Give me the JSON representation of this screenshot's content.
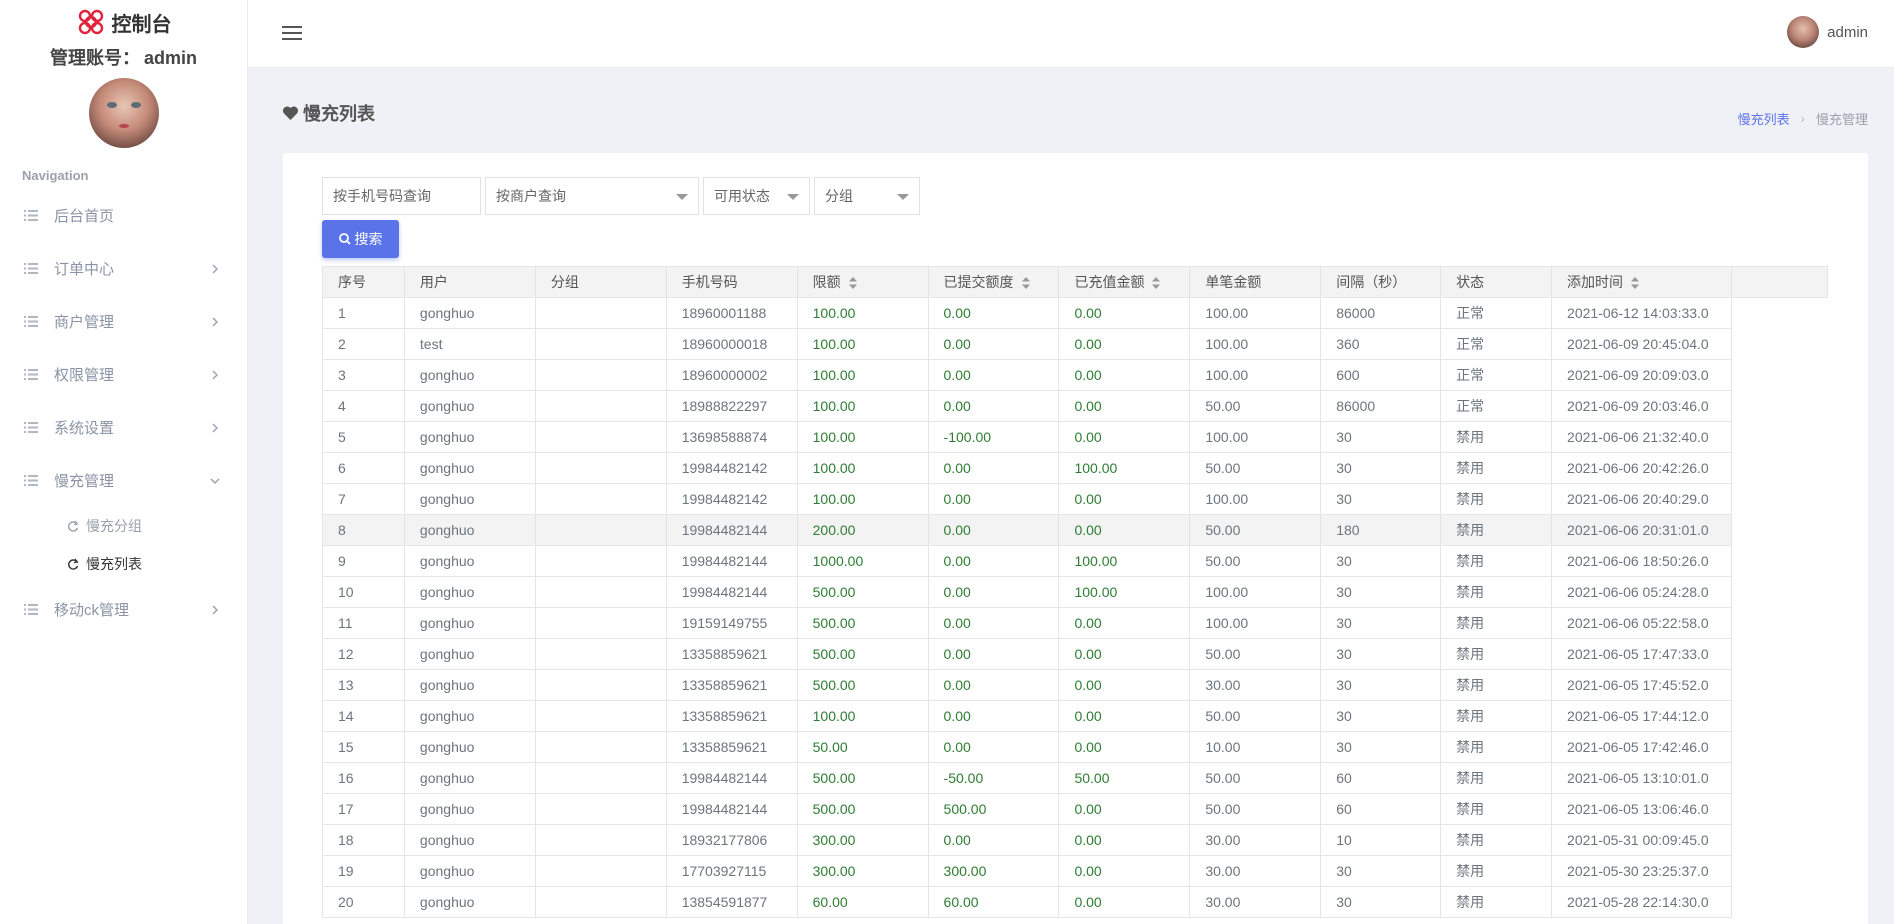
{
  "brand": {
    "title": "控制台"
  },
  "account": {
    "label": "管理账号：",
    "name": "admin"
  },
  "nav": {
    "header": "Navigation",
    "items": [
      {
        "label": "后台首页",
        "has_children": false
      },
      {
        "label": "订单中心",
        "has_children": true
      },
      {
        "label": "商户管理",
        "has_children": true
      },
      {
        "label": "权限管理",
        "has_children": true
      },
      {
        "label": "系统设置",
        "has_children": true
      },
      {
        "label": "慢充管理",
        "has_children": true,
        "expanded": true
      },
      {
        "label": "移动ck管理",
        "has_children": true
      }
    ],
    "sub_items": [
      {
        "label": "慢充分组",
        "active": false
      },
      {
        "label": "慢充列表",
        "active": true
      }
    ]
  },
  "topbar": {
    "user_name": "admin"
  },
  "page": {
    "title": "慢充列表",
    "breadcrumb": [
      "慢充列表",
      "慢充管理"
    ]
  },
  "filters": {
    "phone_placeholder": "按手机号码查询",
    "merchant_select": "按商户查询",
    "status_select": "可用状态",
    "group_select": "分组",
    "search_label": "搜索"
  },
  "table": {
    "columns": [
      "序号",
      "用户",
      "分组",
      "手机号码",
      "限额",
      "已提交额度",
      "已充值金额",
      "单笔金额",
      "间隔（秒）",
      "状态",
      "添加时间"
    ],
    "sortable": [
      false,
      false,
      false,
      false,
      true,
      true,
      true,
      false,
      false,
      false,
      true
    ],
    "rows": [
      [
        "1",
        "gonghuo",
        "",
        "18960001188",
        "100.00",
        "0.00",
        "0.00",
        "100.00",
        "86000",
        "正常",
        "2021-06-12 14:03:33.0"
      ],
      [
        "2",
        "test",
        "",
        "18960000018",
        "100.00",
        "0.00",
        "0.00",
        "100.00",
        "360",
        "正常",
        "2021-06-09 20:45:04.0"
      ],
      [
        "3",
        "gonghuo",
        "",
        "18960000002",
        "100.00",
        "0.00",
        "0.00",
        "100.00",
        "600",
        "正常",
        "2021-06-09 20:09:03.0"
      ],
      [
        "4",
        "gonghuo",
        "",
        "18988822297",
        "100.00",
        "0.00",
        "0.00",
        "50.00",
        "86000",
        "正常",
        "2021-06-09 20:03:46.0"
      ],
      [
        "5",
        "gonghuo",
        "",
        "13698588874",
        "100.00",
        "-100.00",
        "0.00",
        "100.00",
        "30",
        "禁用",
        "2021-06-06 21:32:40.0"
      ],
      [
        "6",
        "gonghuo",
        "",
        "19984482142",
        "100.00",
        "0.00",
        "100.00",
        "50.00",
        "30",
        "禁用",
        "2021-06-06 20:42:26.0"
      ],
      [
        "7",
        "gonghuo",
        "",
        "19984482142",
        "100.00",
        "0.00",
        "0.00",
        "100.00",
        "30",
        "禁用",
        "2021-06-06 20:40:29.0"
      ],
      [
        "8",
        "gonghuo",
        "",
        "19984482144",
        "200.00",
        "0.00",
        "0.00",
        "50.00",
        "180",
        "禁用",
        "2021-06-06 20:31:01.0"
      ],
      [
        "9",
        "gonghuo",
        "",
        "19984482144",
        "1000.00",
        "0.00",
        "100.00",
        "50.00",
        "30",
        "禁用",
        "2021-06-06 18:50:26.0"
      ],
      [
        "10",
        "gonghuo",
        "",
        "19984482144",
        "500.00",
        "0.00",
        "100.00",
        "100.00",
        "30",
        "禁用",
        "2021-06-06 05:24:28.0"
      ],
      [
        "11",
        "gonghuo",
        "",
        "19159149755",
        "500.00",
        "0.00",
        "0.00",
        "100.00",
        "30",
        "禁用",
        "2021-06-06 05:22:58.0"
      ],
      [
        "12",
        "gonghuo",
        "",
        "13358859621",
        "500.00",
        "0.00",
        "0.00",
        "50.00",
        "30",
        "禁用",
        "2021-06-05 17:47:33.0"
      ],
      [
        "13",
        "gonghuo",
        "",
        "13358859621",
        "500.00",
        "0.00",
        "0.00",
        "30.00",
        "30",
        "禁用",
        "2021-06-05 17:45:52.0"
      ],
      [
        "14",
        "gonghuo",
        "",
        "13358859621",
        "100.00",
        "0.00",
        "0.00",
        "50.00",
        "30",
        "禁用",
        "2021-06-05 17:44:12.0"
      ],
      [
        "15",
        "gonghuo",
        "",
        "13358859621",
        "50.00",
        "0.00",
        "0.00",
        "10.00",
        "30",
        "禁用",
        "2021-06-05 17:42:46.0"
      ],
      [
        "16",
        "gonghuo",
        "",
        "19984482144",
        "500.00",
        "-50.00",
        "50.00",
        "50.00",
        "60",
        "禁用",
        "2021-06-05 13:10:01.0"
      ],
      [
        "17",
        "gonghuo",
        "",
        "19984482144",
        "500.00",
        "500.00",
        "0.00",
        "50.00",
        "60",
        "禁用",
        "2021-06-05 13:06:46.0"
      ],
      [
        "18",
        "gonghuo",
        "",
        "18932177806",
        "300.00",
        "0.00",
        "0.00",
        "30.00",
        "10",
        "禁用",
        "2021-05-31 00:09:45.0"
      ],
      [
        "19",
        "gonghuo",
        "",
        "17703927115",
        "300.00",
        "300.00",
        "0.00",
        "30.00",
        "30",
        "禁用",
        "2021-05-30 23:25:37.0"
      ],
      [
        "20",
        "gonghuo",
        "",
        "13854591877",
        "60.00",
        "60.00",
        "0.00",
        "30.00",
        "30",
        "禁用",
        "2021-05-28 22:14:30.0"
      ]
    ],
    "highlighted_row": 8
  },
  "colors": {
    "accent": "#5b73e8",
    "amount_green": "#2e7d32",
    "logo_red": "#e0243c"
  }
}
